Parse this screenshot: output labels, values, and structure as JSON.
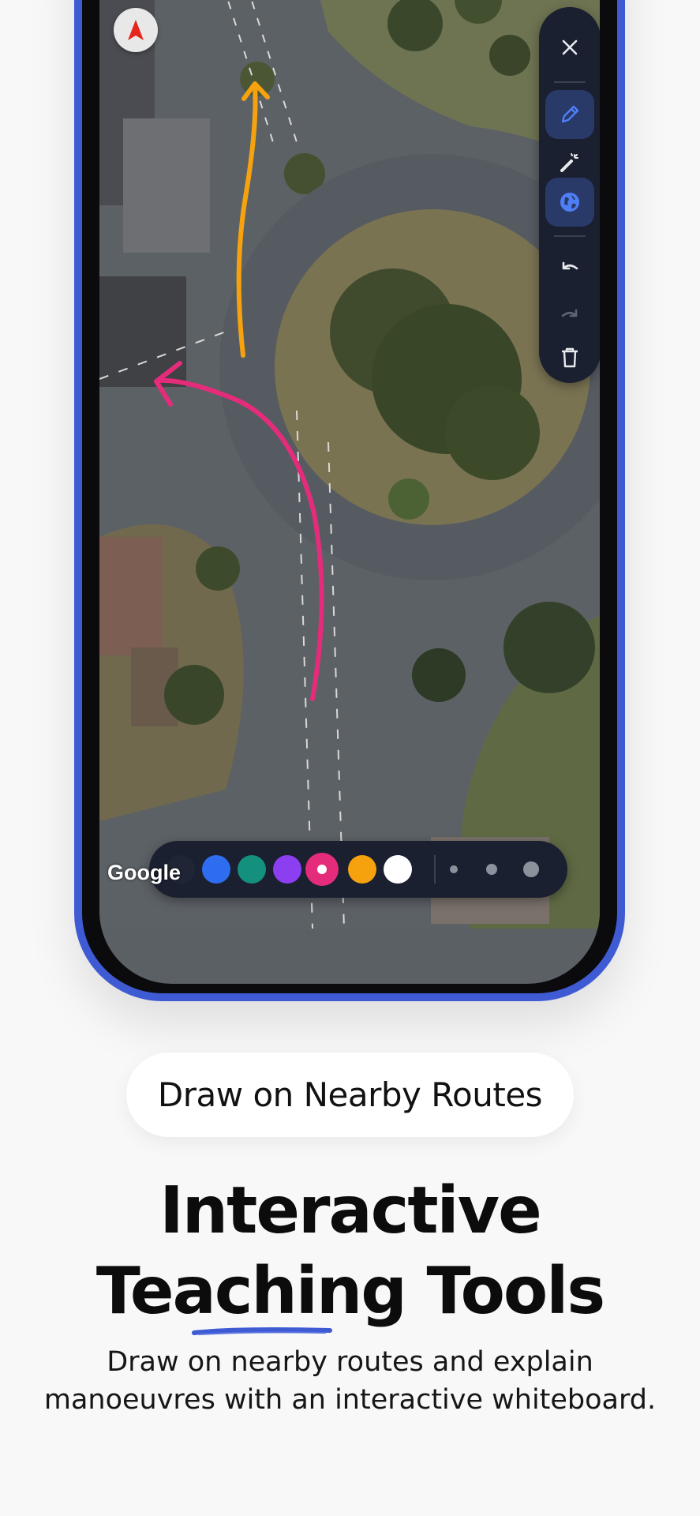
{
  "map": {
    "attribution": "Google",
    "compass_icon": "compass-north-icon"
  },
  "toolbar": {
    "tools": [
      {
        "name": "close",
        "icon": "close-icon",
        "active": false
      },
      {
        "name": "pen",
        "icon": "pencil-icon",
        "active": true
      },
      {
        "name": "laser",
        "icon": "laser-pointer-icon",
        "active": false
      },
      {
        "name": "map",
        "icon": "globe-icon",
        "active": true
      },
      {
        "name": "undo",
        "icon": "undo-icon",
        "active": false
      },
      {
        "name": "redo",
        "icon": "redo-icon",
        "active": false
      },
      {
        "name": "clear",
        "icon": "trash-icon",
        "active": false
      }
    ]
  },
  "palette": {
    "colors": [
      "#1f2535",
      "#2f6df0",
      "#14907e",
      "#8b3ff0",
      "#e52c7b",
      "#f6a20e",
      "#ffffff"
    ],
    "selected_color": "#e52c7b",
    "stroke_sizes": [
      "small",
      "medium",
      "large"
    ]
  },
  "strokes": [
    {
      "color": "#f6a20e",
      "label": "orange-route-arrow"
    },
    {
      "color": "#e52c7b",
      "label": "pink-route-arrow"
    }
  ],
  "feature": {
    "pill_label": "Draw on Nearby Routes",
    "headline_line1": "Interactive",
    "headline_line2": "Teaching Tools",
    "underline_color": "#3f5bd4",
    "description_line1": "Draw on nearby routes and explain",
    "description_line2": "manoeuvres with an interactive whiteboard."
  },
  "colors": {
    "frame": "#3f5bd4",
    "toolbar_bg": "#1a2030",
    "page_bg": "#f8f8f9"
  }
}
